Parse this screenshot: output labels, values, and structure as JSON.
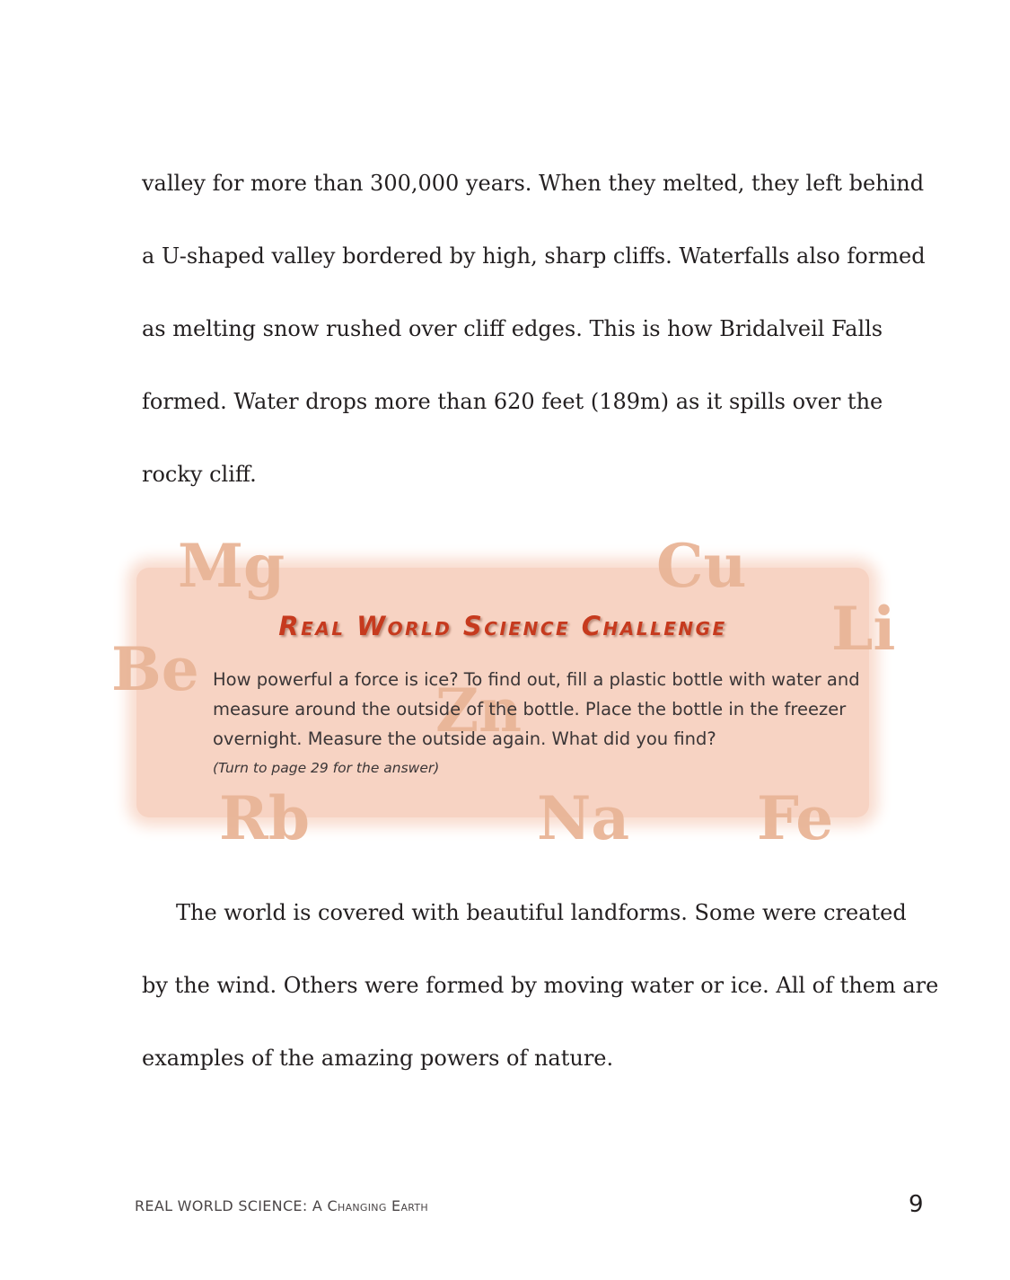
{
  "body": {
    "paragraph1_lines": [
      "valley for more than 300,000 years. When they melted, they left behind",
      "a U-shaped valley bordered by high, sharp cliffs. Waterfalls also formed",
      "as melting snow rushed over cliff edges. This is how Bridalveil Falls",
      "formed. Water drops more than 620 feet (189m) as it spills over the",
      "rocky cliff."
    ],
    "paragraph2_lines": [
      "The world is covered with beautiful landforms. Some were created",
      "by the wind. Others were formed by moving water or ice. All of them are",
      "examples of the amazing powers of nature."
    ]
  },
  "challenge": {
    "title": "Real World Science Challenge",
    "text_lines": [
      "How powerful a force is ice? To find out, fill a plastic bottle with water and",
      "measure around the outside of the bottle. Place the bottle in the freezer",
      "overnight. Measure the outside again. What did you find?"
    ],
    "note": "(Turn to page 29 for the answer)",
    "element_symbols": [
      "Mg",
      "Cu",
      "Li",
      "Be",
      "Zn",
      "Rb",
      "Na",
      "Fe"
    ],
    "colors": {
      "box": "#f7d3c3",
      "title": "#c63a1e",
      "symbols": "#e9b597"
    }
  },
  "footer": {
    "book_title_part1": "REAL WORLD SCIENCE: ",
    "book_title_part2": "A Changing Earth",
    "page_number": "9"
  }
}
